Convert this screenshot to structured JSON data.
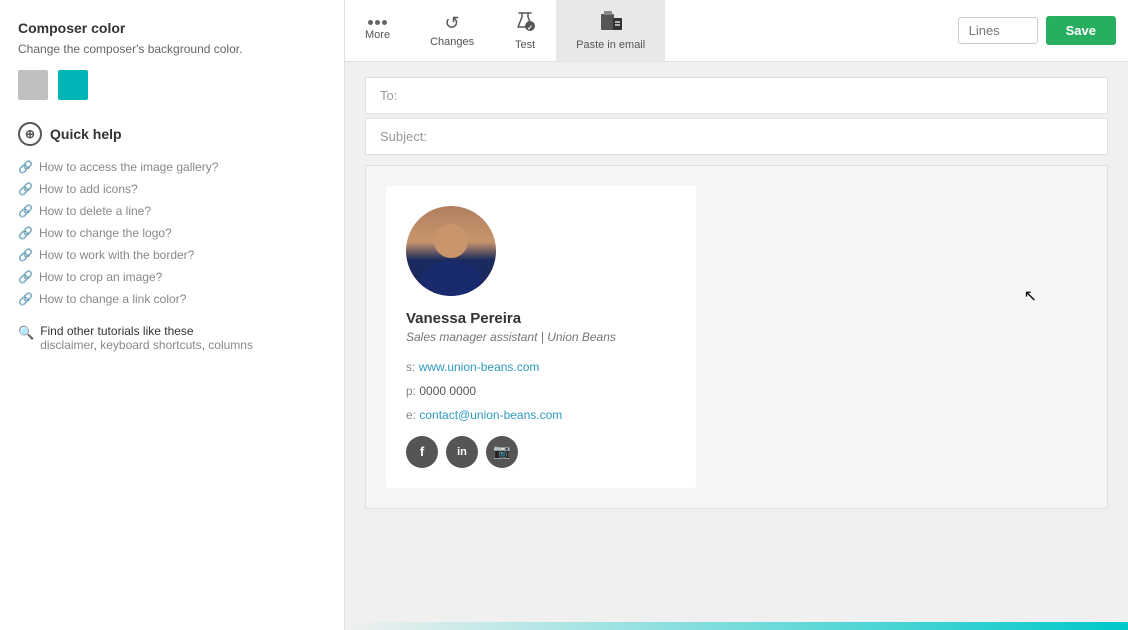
{
  "sidebar": {
    "composerColor": {
      "title": "Composer color",
      "description": "Change the composer's background color.",
      "swatches": [
        {
          "color": "#c0c0c0",
          "name": "gray"
        },
        {
          "color": "#00b5b5",
          "name": "teal"
        }
      ]
    },
    "quickHelp": {
      "title": "Quick help",
      "links": [
        {
          "text": "How to access the image gallery?"
        },
        {
          "text": "How to add icons?"
        },
        {
          "text": "How to delete a line?"
        },
        {
          "text": "How to change the logo?"
        },
        {
          "text": "How to work with the border?"
        },
        {
          "text": "How to crop an image?"
        },
        {
          "text": "How to change a link color?"
        }
      ],
      "findTutorials": {
        "prefix": "Find other tutorials like these",
        "links": "disclaimer, keyboard shortcuts, columns"
      }
    }
  },
  "toolbar": {
    "buttons": [
      {
        "id": "more",
        "label": "More"
      },
      {
        "id": "changes",
        "label": "Changes"
      },
      {
        "id": "test",
        "label": "Test"
      },
      {
        "id": "paste-in-email",
        "label": "Paste in email"
      }
    ],
    "linesPlaceholder": "Lines",
    "saveLabel": "Save"
  },
  "compose": {
    "toPlaceholder": "To:",
    "subjectPlaceholder": "Subject:"
  },
  "signature": {
    "name": "Vanessa Pereira",
    "title": "Sales manager assistant | Union Beans",
    "website": {
      "label": "s:",
      "url": "www.union-beans.com"
    },
    "phone": {
      "label": "p:",
      "value": "0000 0000"
    },
    "email": {
      "label": "e:",
      "value": "contact@union-beans.com"
    },
    "social": [
      {
        "name": "facebook",
        "letter": "f"
      },
      {
        "name": "linkedin",
        "letter": "in"
      },
      {
        "name": "instagram",
        "letter": "📷"
      }
    ]
  }
}
